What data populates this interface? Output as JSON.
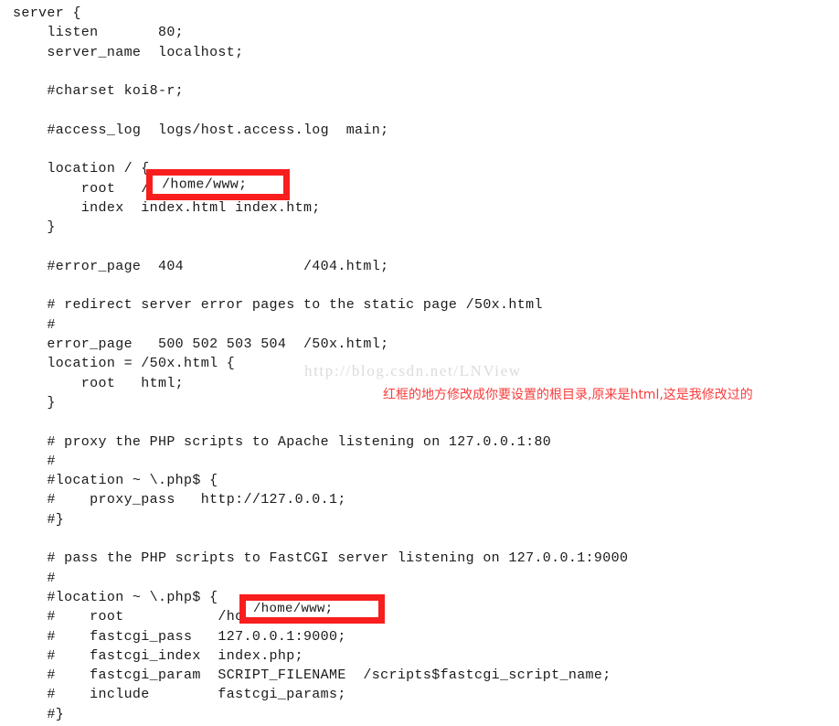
{
  "document": {
    "kind": "nginx-configuration-listing",
    "language": "nginx.conf"
  },
  "code": {
    "lines": [
      "server {",
      "    listen       80;",
      "    server_name  localhost;",
      "",
      "    #charset koi8-r;",
      "",
      "    #access_log  logs/host.access.log  main;",
      "",
      "    location / {",
      "        root   /home/www;",
      "        index  index.html index.htm;",
      "    }",
      "",
      "    #error_page  404              /404.html;",
      "",
      "    # redirect server error pages to the static page /50x.html",
      "    #",
      "    error_page   500 502 503 504  /50x.html;",
      "    location = /50x.html {",
      "        root   html;",
      "    }",
      "",
      "    # proxy the PHP scripts to Apache listening on 127.0.0.1:80",
      "    #",
      "    #location ~ \\.php$ {",
      "    #    proxy_pass   http://127.0.0.1;",
      "    #}",
      "",
      "    # pass the PHP scripts to FastCGI server listening on 127.0.0.1:9000",
      "    #",
      "    #location ~ \\.php$ {",
      "    #    root           /home/www;",
      "    #    fastcgi_pass   127.0.0.1:9000;",
      "    #    fastcgi_index  index.php;",
      "    #    fastcgi_param  SCRIPT_FILENAME  /scripts$fastcgi_script_name;",
      "    #    include        fastcgi_params;",
      "    #}"
    ]
  },
  "highlights": {
    "root_main": {
      "text": "/home/www;",
      "border_color": "#f81e1e"
    },
    "root_fastcgi": {
      "text": "/home/www;",
      "border_color": "#f81e1e"
    }
  },
  "watermark": {
    "text": "http://blog.csdn.net/LNView",
    "color": "#dcdcdc"
  },
  "annotation": {
    "text": "红框的地方修改成你要设置的根目录,原来是html,这是我修改过的",
    "color": "#fa3c3c"
  }
}
